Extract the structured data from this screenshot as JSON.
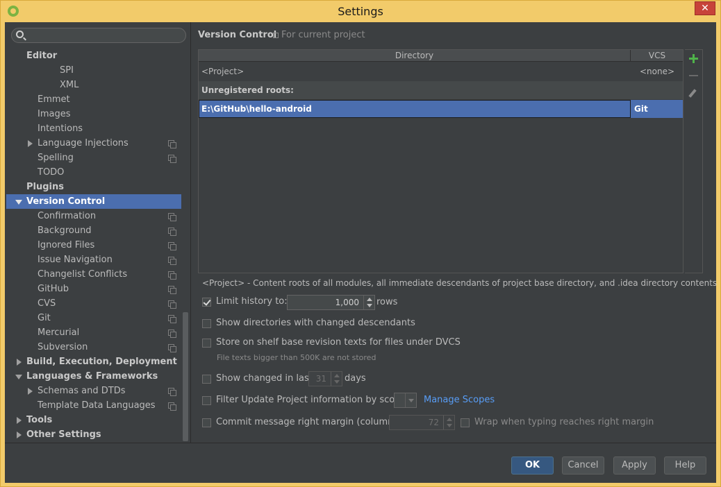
{
  "window": {
    "title": "Settings",
    "close_glyph": "✕"
  },
  "search": {
    "placeholder": ""
  },
  "tree": {
    "editor": "Editor",
    "spi": "SPI",
    "xml": "XML",
    "emmet": "Emmet",
    "images": "Images",
    "intentions": "Intentions",
    "language_injections": "Language Injections",
    "spelling": "Spelling",
    "todo": "TODO",
    "plugins": "Plugins",
    "version_control": "Version Control",
    "confirmation": "Confirmation",
    "background": "Background",
    "ignored_files": "Ignored Files",
    "issue_navigation": "Issue Navigation",
    "changelist_conflicts": "Changelist Conflicts",
    "github": "GitHub",
    "cvs": "CVS",
    "git": "Git",
    "mercurial": "Mercurial",
    "subversion": "Subversion",
    "build": "Build, Execution, Deployment",
    "languages": "Languages & Frameworks",
    "schemas": "Schemas and DTDs",
    "template_data": "Template Data Languages",
    "tools": "Tools",
    "other": "Other Settings"
  },
  "panel": {
    "title": "Version Control",
    "scope": "For current project",
    "table": {
      "headers": {
        "directory": "Directory",
        "vcs": "VCS"
      },
      "project_row": {
        "dir": "<Project>",
        "vcs": "<none>"
      },
      "group_label": "Unregistered roots:",
      "selected_row": {
        "dir": "E:\\GitHub\\hello-android",
        "vcs": "Git"
      }
    },
    "note": "<Project> - Content roots of all modules, all immediate descendants of project base directory, and .idea directory contents",
    "options": {
      "limit_history": {
        "label": "Limit history to:",
        "value": "1,000",
        "suffix": "rows",
        "checked": true
      },
      "show_dirs": {
        "label": "Show directories with changed descendants"
      },
      "store_shelf": {
        "label": "Store on shelf base revision texts for files under DVCS",
        "hint": "File texts bigger than 500K are not stored"
      },
      "show_changed": {
        "label": "Show changed in last",
        "value": "31",
        "suffix": "days"
      },
      "filter_update": {
        "label": "Filter Update Project information by scope",
        "link": "Manage Scopes"
      },
      "commit_margin": {
        "label": "Commit message right margin (columns):",
        "value": "72",
        "wrap_label": "Wrap when typing reaches right margin"
      }
    }
  },
  "footer": {
    "ok": "OK",
    "cancel": "Cancel",
    "apply": "Apply",
    "help": "Help"
  },
  "colors": {
    "selection": "#4b6eaf",
    "background": "#3c3f41",
    "link": "#589df6",
    "accent_add": "#4fb34a"
  }
}
